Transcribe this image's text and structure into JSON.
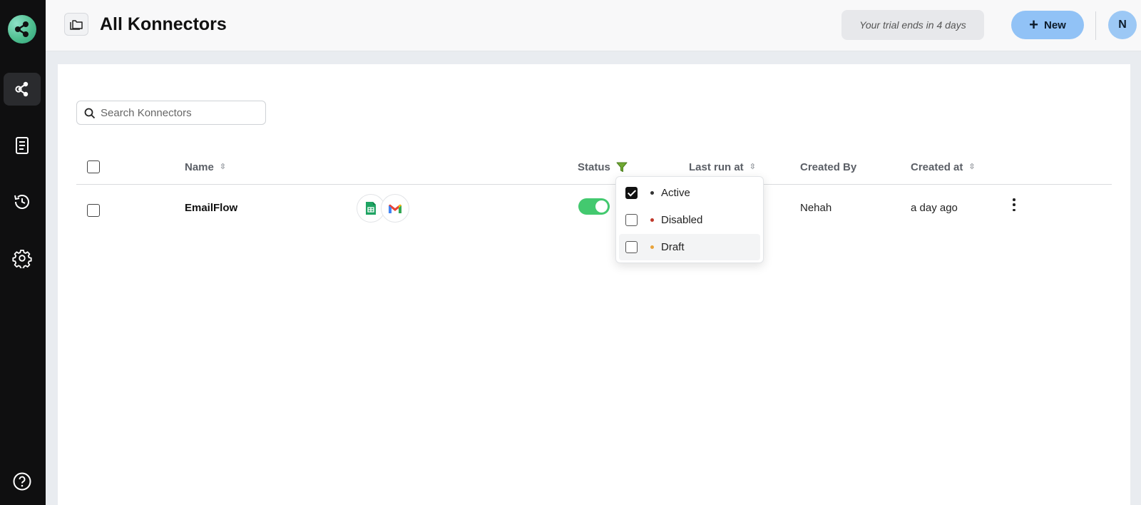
{
  "header": {
    "title": "All Konnectors",
    "trial_text": "Your trial ends in 4 days",
    "new_button": "New",
    "avatar_initial": "N"
  },
  "sidebar": {
    "items": [
      {
        "icon": "share-icon",
        "active": true
      },
      {
        "icon": "document-icon",
        "active": false
      },
      {
        "icon": "history-icon",
        "active": false
      },
      {
        "icon": "gear-icon",
        "active": false
      },
      {
        "icon": "help-icon",
        "active": false
      }
    ]
  },
  "search": {
    "placeholder": "Search Konnectors"
  },
  "table": {
    "columns": [
      "Name",
      "Status",
      "Last run at",
      "Created By",
      "Created at"
    ],
    "rows": [
      {
        "name": "EmailFlow",
        "apps": [
          "google-sheets-icon",
          "gmail-icon"
        ],
        "status_on": true,
        "created_by": "Nehah",
        "created_at": "a day ago"
      }
    ]
  },
  "status_filter": {
    "options": [
      {
        "label": "Active",
        "checked": true,
        "color": "#333333"
      },
      {
        "label": "Disabled",
        "checked": false,
        "color": "#c0392b"
      },
      {
        "label": "Draft",
        "checked": false,
        "color": "#e8a33a"
      }
    ]
  },
  "colors": {
    "accent": "#91c2f6",
    "toggle_on": "#43c96f",
    "filter_icon": "#6fa832"
  }
}
